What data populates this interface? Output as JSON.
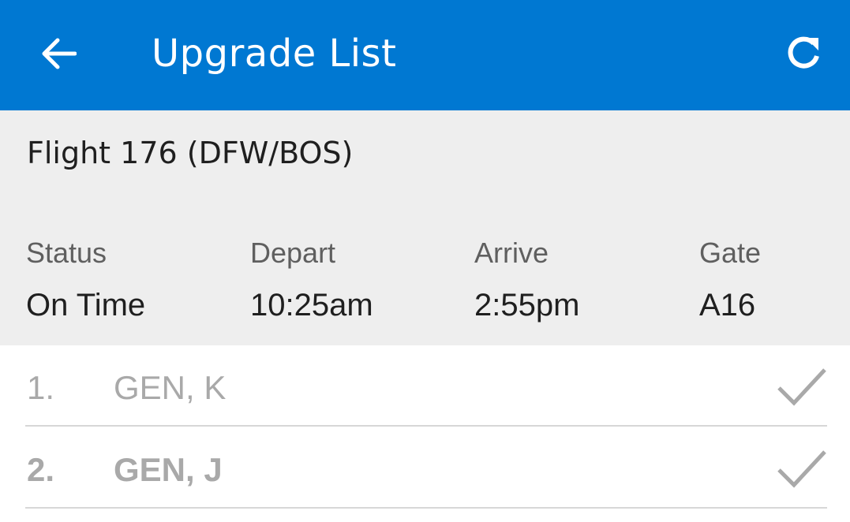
{
  "header": {
    "title": "Upgrade List",
    "back_icon": "arrow-left-icon",
    "refresh_icon": "refresh-icon",
    "background_color": "#0078d2"
  },
  "flight": {
    "title": "Flight 176 (DFW/BOS)",
    "columns": [
      {
        "label": "Status",
        "value": "On Time"
      },
      {
        "label": "Depart",
        "value": "10:25am"
      },
      {
        "label": "Arrive",
        "value": "2:55pm"
      },
      {
        "label": "Gate",
        "value": "A16"
      }
    ]
  },
  "upgrade_list": [
    {
      "number": "1.",
      "name": "GEN, K",
      "icon": "checkmark-icon"
    },
    {
      "number": "2.",
      "name": "GEN, J",
      "icon": "checkmark-icon"
    }
  ]
}
